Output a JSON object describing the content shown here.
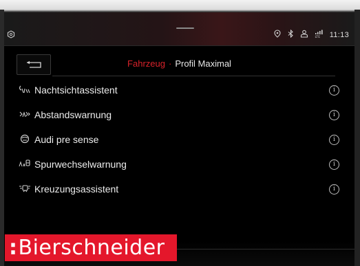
{
  "status_bar": {
    "left_icon": "gear-hex-icon",
    "icons": [
      "location-icon",
      "bluetooth-icon",
      "user-icon",
      "lte-signal-icon"
    ],
    "time": "11:13"
  },
  "header": {
    "back_icon": "back-arrow-icon",
    "breadcrumb_parent": "Fahrzeug",
    "breadcrumb_separator": "·",
    "breadcrumb_current": "Profil Maximal"
  },
  "items": [
    {
      "icon": "night-vision-icon",
      "label": "Nachtsichtassistent"
    },
    {
      "icon": "distance-warning-icon",
      "label": "Abstandswarnung"
    },
    {
      "icon": "pre-sense-icon",
      "label": "Audi pre sense"
    },
    {
      "icon": "lane-change-icon",
      "label": "Spurwechselwarnung"
    },
    {
      "icon": "cross-traffic-icon",
      "label": "Kreuzungsassistent"
    }
  ],
  "watermark": {
    "colon": ":",
    "text": "Bierschneider"
  },
  "colors": {
    "accent": "#d9222a",
    "watermark_bg": "#e4172b",
    "background": "#000000",
    "text": "#ededed"
  }
}
